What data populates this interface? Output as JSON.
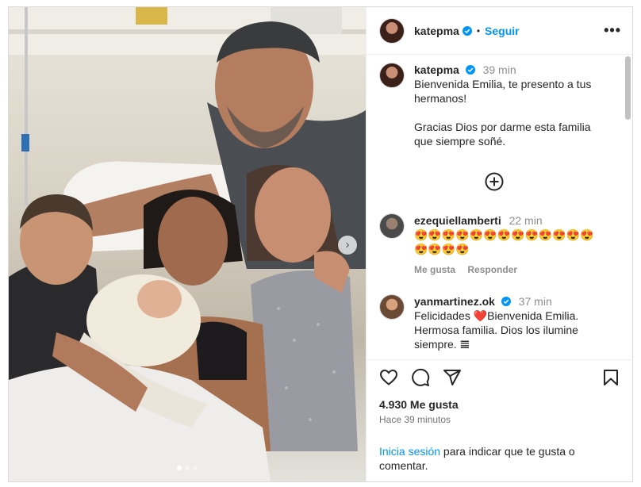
{
  "post": {
    "username": "katepma",
    "follow_label": "Seguir",
    "separator": "•",
    "more_label": "•••",
    "caption_time": "39 min",
    "caption_line1": "Bienvenida Emilia, te presento a tus hermanos!",
    "caption_line2": "Gracias Dios por darme esta familia que siempre soñé.",
    "load_more_icon": "plus-circle-icon",
    "next_icon": "chevron-right-icon"
  },
  "comments": [
    {
      "username": "ezequiellamberti",
      "time": "22 min",
      "text": "😍😍😍😍😍😍😍😍😍😍😍😍😍😍😍😍😍",
      "like_label": "Me gusta",
      "reply_label": "Responder"
    },
    {
      "username": "yanmartinez.ok",
      "time": "37 min",
      "text": "Felicidades ❤️Bienvenida Emilia. Hermosa familia. Dios los ilumine siempre. 𝌆"
    }
  ],
  "footer": {
    "likes": "4.930 Me gusta",
    "ago": "Hace 39 minutos",
    "login_link": "Inicia sesión",
    "login_rest": " para indicar que te gusta o comentar."
  },
  "carousel": {
    "count": 3,
    "active_index": 0
  },
  "colors": {
    "link": "#0095f6",
    "verified": "#0095f6",
    "text": "#262626",
    "muted": "#8e8e8e"
  }
}
